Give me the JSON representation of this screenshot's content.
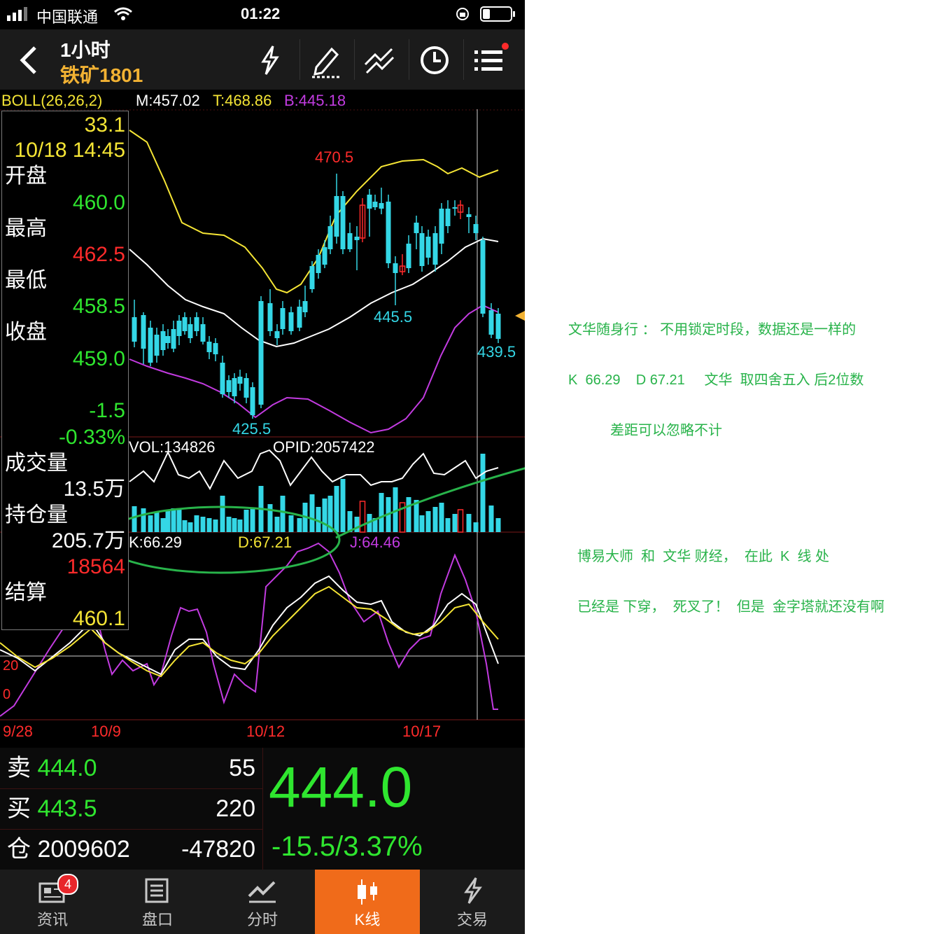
{
  "status_bar": {
    "carrier": "中国联通",
    "time": "01:22"
  },
  "header": {
    "period": "1小时",
    "symbol": "铁矿1801"
  },
  "boll": {
    "label": "BOLL(26,26,2)",
    "m": "M:457.02",
    "t": "T:468.86",
    "b": "B:445.18"
  },
  "info_panel": {
    "value_top": "33.1",
    "datetime": "10/18 14:45",
    "open_label": "开盘",
    "open": "460.0",
    "high_label": "最高",
    "high": "462.5",
    "low_label": "最低",
    "low": "458.5",
    "close_label": "收盘",
    "close": "459.0",
    "change": "-1.5",
    "change_pct": "-0.33%",
    "volume_label": "成交量",
    "volume": "13.5万",
    "oi_label": "持仓量",
    "oi": "205.7万",
    "oi_change": "18564",
    "settle_label": "结算",
    "settle": "460.1"
  },
  "price_annotations": {
    "high": "470.5",
    "low1": "425.5",
    "mid": "445.5",
    "last": "439.5"
  },
  "volume_panel": {
    "vol": "VOL:134826",
    "opid": "OPID:2057422"
  },
  "kdj": {
    "k": "K:66.29",
    "d": "D:67.21",
    "j": "J:64.46",
    "lvl20": "20",
    "lvl0": "0"
  },
  "x_axis": {
    "labels": [
      "9/28",
      "10/9",
      "10/12",
      "10/17"
    ]
  },
  "order_book": {
    "sell_label": "卖",
    "sell_price": "444.0",
    "sell_qty": "55",
    "buy_label": "买",
    "buy_price": "443.5",
    "buy_qty": "220",
    "oi_label": "仓",
    "oi": "2009602",
    "oi_chg": "-47820",
    "last_price": "444.0",
    "change": "-15.5/3.37%"
  },
  "tabs": {
    "news": "资讯",
    "news_badge": "4",
    "quote": "盘口",
    "intraday": "分时",
    "kline": "K线",
    "trade": "交易"
  },
  "notes": {
    "n1": "文华随身行 ： 不用锁定时段，数据还是一样的",
    "n2": "K  66.29    D 67.21     文华  取四舍五入 后2位数",
    "n3": "差距可以忽略不计",
    "n4": "博易大师  和  文华 财经，  在此  K  线 处",
    "n5": "已经是 下穿，  死叉了！  但是  金字塔就还没有啊"
  },
  "colors": {
    "bg": "#000000",
    "up": "#ff2b2b",
    "down": "#34d7e6",
    "mid_line": "#ffffff",
    "upper_line": "#f5e535",
    "lower_line": "#c23be0",
    "accent": "#f06b1a",
    "annotation": "#28b34a"
  }
}
